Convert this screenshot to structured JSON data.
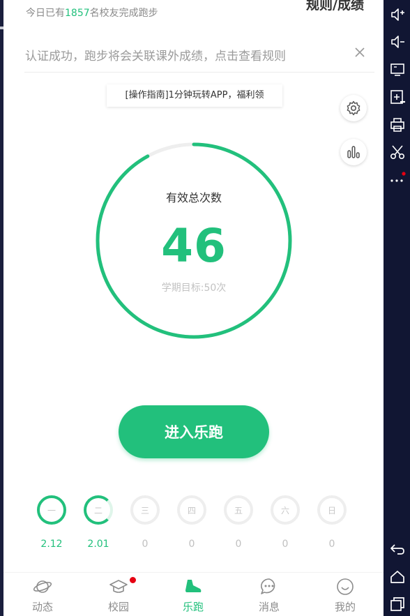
{
  "header": {
    "runners_prefix": "今日已有",
    "runners_count": "1857",
    "runners_suffix": "名校友完成跑步",
    "rules_link": "规则/成绩"
  },
  "notice": {
    "text": "认证成功，跑步将会关联课外成绩，点击查看规则",
    "close_icon": "close-icon"
  },
  "guide_banner": "[操作指南]1分钟玩转APP，福利领",
  "progress": {
    "label": "有效总次数",
    "value": "46",
    "goal_text": "学期目标:50次",
    "goal": 50,
    "completed": 46,
    "ring_color": "#22c07c",
    "track_color": "#eeeeee"
  },
  "start_button": "进入乐跑",
  "week": [
    {
      "day": "一",
      "distance": "2.12",
      "status": "done"
    },
    {
      "day": "二",
      "distance": "2.01",
      "status": "partial"
    },
    {
      "day": "三",
      "distance": "0",
      "status": "none"
    },
    {
      "day": "四",
      "distance": "0",
      "status": "none"
    },
    {
      "day": "五",
      "distance": "0",
      "status": "none"
    },
    {
      "day": "六",
      "distance": "0",
      "status": "none"
    },
    {
      "day": "日",
      "distance": "0",
      "status": "none"
    }
  ],
  "tabs": [
    {
      "label": "动态",
      "icon": "planet-icon"
    },
    {
      "label": "校园",
      "icon": "graduation-cap-icon",
      "badge": true
    },
    {
      "label": "乐跑",
      "icon": "running-shoe-icon",
      "active": true
    },
    {
      "label": "消息",
      "icon": "chat-bubble-icon"
    },
    {
      "label": "我的",
      "icon": "smile-face-icon"
    }
  ],
  "side_toolbar": [
    "volume-up-icon",
    "volume-down-icon",
    "screen-icon",
    "apk-install-icon",
    "printer-icon",
    "scissors-icon",
    "more-icon",
    "back-icon",
    "home-icon",
    "recent-apps-icon"
  ],
  "colors": {
    "accent": "#22c07c",
    "badge": "#e60012",
    "toolbar_bg": "#111633"
  }
}
